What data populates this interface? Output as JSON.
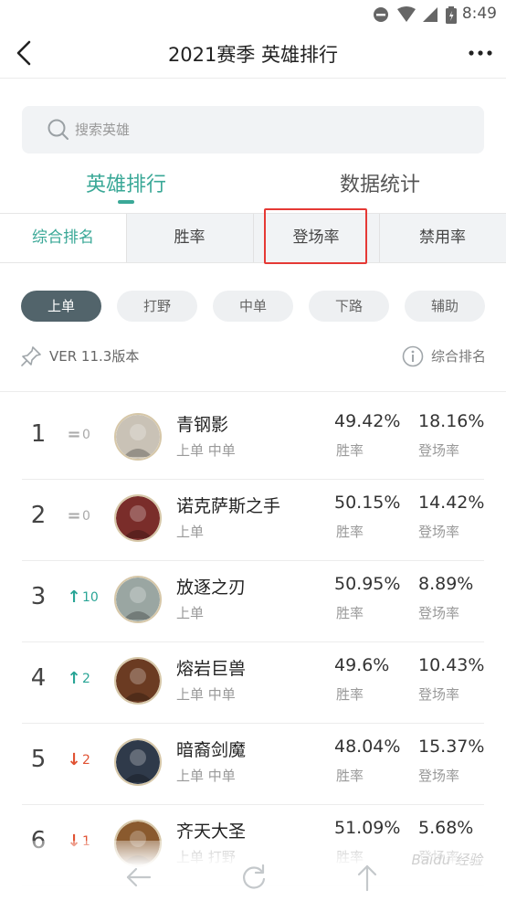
{
  "status_bar": {
    "time": "8:49"
  },
  "header": {
    "title": "2021赛季 英雄排行"
  },
  "search": {
    "placeholder": "搜索英雄"
  },
  "main_tabs": [
    {
      "label": "英雄排行",
      "active": true
    },
    {
      "label": "数据统计",
      "active": false
    }
  ],
  "sub_tabs": [
    {
      "label": "综合排名",
      "active": true
    },
    {
      "label": "胜率",
      "active": false
    },
    {
      "label": "登场率",
      "active": false
    },
    {
      "label": "禁用率",
      "active": false
    }
  ],
  "lanes": [
    {
      "label": "上单",
      "active": true
    },
    {
      "label": "打野",
      "active": false
    },
    {
      "label": "中单",
      "active": false
    },
    {
      "label": "下路",
      "active": false
    },
    {
      "label": "辅助",
      "active": false
    }
  ],
  "info": {
    "version": "VER 11.3版本",
    "sort": "综合排名"
  },
  "labels": {
    "win_rate": "胜率",
    "pick_rate": "登场率"
  },
  "heroes": [
    {
      "rank": "1",
      "change_dir": "same",
      "change": "0",
      "name": "青钢影",
      "positions": "上单 中单",
      "win_rate": "49.42%",
      "pick_rate": "18.16%"
    },
    {
      "rank": "2",
      "change_dir": "same",
      "change": "0",
      "name": "诺克萨斯之手",
      "positions": "上单",
      "win_rate": "50.15%",
      "pick_rate": "14.42%"
    },
    {
      "rank": "3",
      "change_dir": "up",
      "change": "10",
      "name": "放逐之刃",
      "positions": "上单",
      "win_rate": "50.95%",
      "pick_rate": "8.89%"
    },
    {
      "rank": "4",
      "change_dir": "up",
      "change": "2",
      "name": "熔岩巨兽",
      "positions": "上单 中单",
      "win_rate": "49.6%",
      "pick_rate": "10.43%"
    },
    {
      "rank": "5",
      "change_dir": "down",
      "change": "2",
      "name": "暗裔剑魔",
      "positions": "上单 中单",
      "win_rate": "48.04%",
      "pick_rate": "15.37%"
    },
    {
      "rank": "6",
      "change_dir": "down",
      "change": "1",
      "name": "齐天大圣",
      "positions": "上单 打野",
      "win_rate": "51.09%",
      "pick_rate": "5.68%"
    }
  ],
  "watermark": "Baidu 经验",
  "colors": {
    "accent": "#3aa897",
    "up": "#2aa596",
    "down": "#e05233",
    "chip_active": "#52646b",
    "highlight": "#e53935"
  }
}
